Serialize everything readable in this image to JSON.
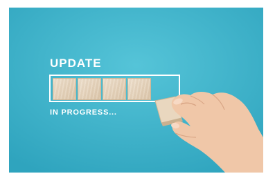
{
  "headline": "UPDATE",
  "caption": "IN PROGRESS...",
  "progress": {
    "filled_blocks": 4,
    "held_blocks": 1
  },
  "colors": {
    "background": "#3fb1c9",
    "text": "#ffffff",
    "wood": "#e6d3ba"
  }
}
